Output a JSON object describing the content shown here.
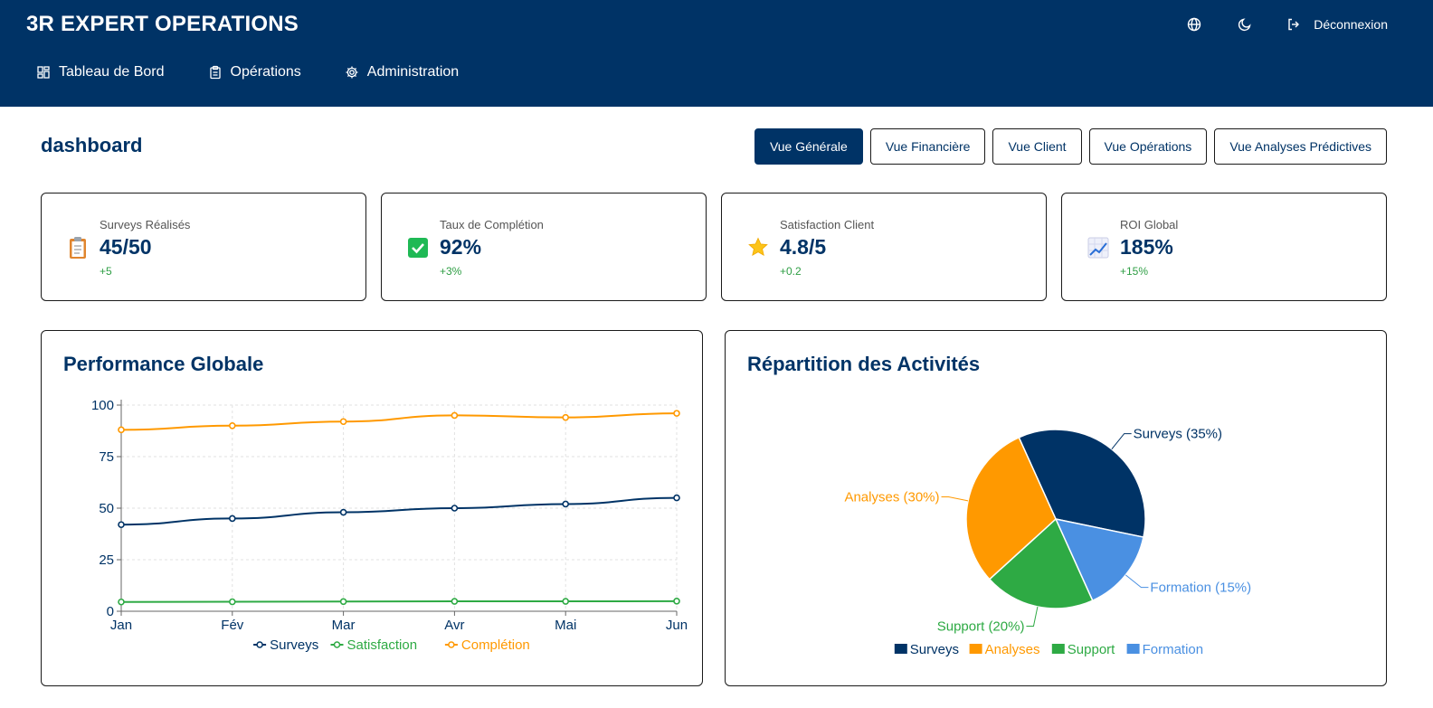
{
  "app": {
    "title": "3R EXPERT OPERATIONS",
    "logout_label": "Déconnexion"
  },
  "icons": {
    "language": "globe-icon",
    "theme": "moon-icon",
    "logout": "logout-icon"
  },
  "nav": [
    {
      "label": "Tableau de Bord",
      "icon": "dashboard-icon"
    },
    {
      "label": "Opérations",
      "icon": "clipboard-icon"
    },
    {
      "label": "Administration",
      "icon": "gear-icon"
    }
  ],
  "page": {
    "title": "dashboard"
  },
  "view_tabs": [
    {
      "label": "Vue Générale",
      "active": true
    },
    {
      "label": "Vue Financière",
      "active": false
    },
    {
      "label": "Vue Client",
      "active": false
    },
    {
      "label": "Vue Opérations",
      "active": false
    },
    {
      "label": "Vue Analyses Prédictives",
      "active": false
    }
  ],
  "kpis": [
    {
      "label": "Surveys Réalisés",
      "value": "45/50",
      "delta": "+5",
      "icon": "clipboard-emoji-icon"
    },
    {
      "label": "Taux de Complétion",
      "value": "92%",
      "delta": "+3%",
      "icon": "check-box-icon"
    },
    {
      "label": "Satisfaction Client",
      "value": "4.8/5",
      "delta": "+0.2",
      "icon": "star-icon"
    },
    {
      "label": "ROI Global",
      "value": "185%",
      "delta": "+15%",
      "icon": "chart-increasing-icon"
    }
  ],
  "colors": {
    "primary": "#003366",
    "orange": "#ff9900",
    "green": "#2eaa44",
    "blue": "#4a90e2",
    "delta": "#2e9e44"
  },
  "chart_data": [
    {
      "type": "line",
      "title": "Performance Globale",
      "x": [
        "Jan",
        "Fév",
        "Mar",
        "Avr",
        "Mai",
        "Jun"
      ],
      "ylim": [
        0,
        100
      ],
      "yticks": [
        0,
        25,
        50,
        75,
        100
      ],
      "grid": true,
      "legend": "bottom",
      "series": [
        {
          "name": "Surveys",
          "color": "#003366",
          "values": [
            42,
            45,
            48,
            50,
            52,
            55
          ]
        },
        {
          "name": "Satisfaction",
          "color": "#2eaa44",
          "values": [
            4.5,
            4.6,
            4.7,
            4.8,
            4.8,
            4.9
          ]
        },
        {
          "name": "Complétion",
          "color": "#ff9900",
          "values": [
            88,
            90,
            92,
            95,
            94,
            96
          ]
        }
      ]
    },
    {
      "type": "pie",
      "title": "Répartition des Activités",
      "legend": "bottom",
      "slices": [
        {
          "name": "Surveys",
          "value": 35,
          "label": "Surveys (35%)",
          "color": "#003366"
        },
        {
          "name": "Formation",
          "value": 15,
          "label": "Formation (15%)",
          "color": "#4a90e2"
        },
        {
          "name": "Support",
          "value": 20,
          "label": "Support (20%)",
          "color": "#2eaa44"
        },
        {
          "name": "Analyses",
          "value": 30,
          "label": "Analyses (30%)",
          "color": "#ff9900"
        }
      ],
      "legend_items": [
        {
          "name": "Surveys",
          "color": "#003366"
        },
        {
          "name": "Analyses",
          "color": "#ff9900"
        },
        {
          "name": "Support",
          "color": "#2eaa44"
        },
        {
          "name": "Formation",
          "color": "#4a90e2"
        }
      ]
    }
  ]
}
